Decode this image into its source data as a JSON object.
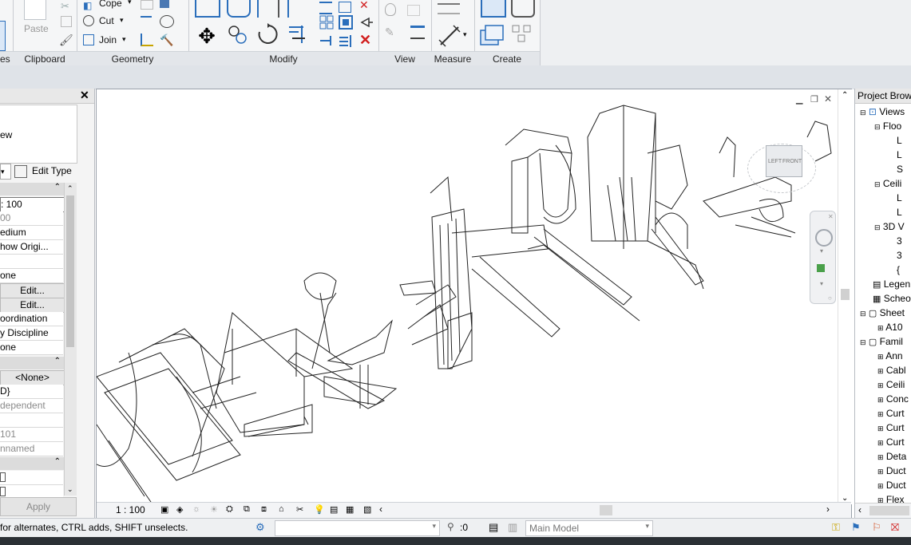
{
  "ribbon": {
    "panels": {
      "clipboard": "Clipboard",
      "geometry": "Geometry",
      "modify": "Modify",
      "view": "View",
      "measure": "Measure",
      "create": "Create"
    },
    "left_cut_label": "es",
    "paste_label": "Paste",
    "cope_label": "Cope",
    "cut_label": "Cut",
    "join_label": "Join"
  },
  "properties": {
    "partial_text_1": "ew",
    "edit_type_label": "Edit Type",
    "rows": [
      ": 100",
      "00",
      "edium",
      "how Origi...",
      "",
      "one",
      "Edit...",
      "Edit...",
      "oordination",
      "y Discipline",
      "one",
      "<None>",
      "D}",
      "dependent",
      "",
      "101",
      "nnamed",
      "",
      ""
    ],
    "apply_label": "Apply"
  },
  "viewport": {
    "scale_label": "1 : 100",
    "viewcube_left": "LEFT",
    "viewcube_front": "FRONT"
  },
  "browser": {
    "title": "Project Brows",
    "items": [
      "Views",
      "Floo",
      "L",
      "L",
      "S",
      "Ceili",
      "L",
      "L",
      "3D V",
      "3",
      "3",
      "{",
      "Legen",
      "Scheo",
      "Sheet",
      "A10",
      "Famil",
      "Ann",
      "Cabl",
      "Ceili",
      "Conc",
      "Curt",
      "Curt",
      "Curt",
      "Deta",
      "Duct",
      "Duct",
      "Flex"
    ]
  },
  "status": {
    "hint": "for alternates, CTRL adds, SHIFT unselects.",
    "worksets_value": ":0",
    "model_label": "Main Model"
  },
  "colors": {
    "ribbon_bg": "#f5f6f7",
    "band_bg": "#dfe3e8",
    "accent_blue": "#2a6ebb",
    "delete_red": "#d11f1f"
  }
}
